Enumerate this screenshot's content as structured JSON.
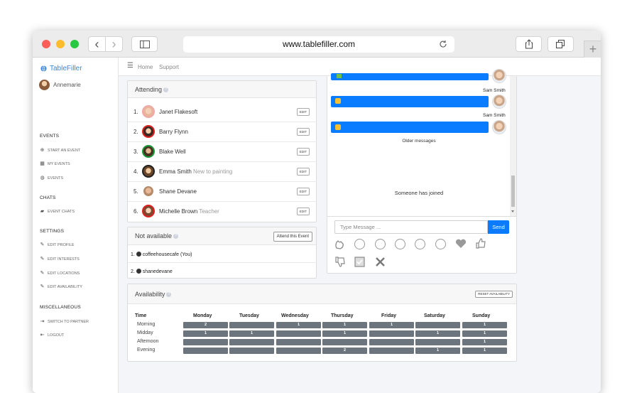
{
  "browser": {
    "url": "www.tablefiller.com",
    "back_glyph": "‹",
    "forward_glyph": "›",
    "new_tab_glyph": "+"
  },
  "sidebar": {
    "brand": "TableFiller",
    "user": "Annemarie",
    "sections": [
      {
        "title": "EVENTS",
        "items": [
          {
            "label": "START AN EVENT",
            "icon": "plus-circle-icon"
          },
          {
            "label": "MY EVENTS",
            "icon": "calendar-icon"
          },
          {
            "label": "EVENTS",
            "icon": "globe-icon"
          }
        ]
      },
      {
        "title": "CHATS",
        "items": [
          {
            "label": "EVENT CHATS",
            "icon": "chat-icon"
          }
        ]
      },
      {
        "title": "SETTINGS",
        "items": [
          {
            "label": "EDIT PROFILE",
            "icon": "edit-icon"
          },
          {
            "label": "EDIT INTERESTS",
            "icon": "edit-icon"
          },
          {
            "label": "EDIT LOCATIONS",
            "icon": "edit-icon"
          },
          {
            "label": "EDIT AVAILABILITY",
            "icon": "edit-icon"
          }
        ]
      },
      {
        "title": "MISCELLANEOUS",
        "items": [
          {
            "label": "SWITCH TO PARTNER",
            "icon": "sign-in-icon"
          },
          {
            "label": "LOGOUT",
            "icon": "sign-out-icon"
          }
        ]
      }
    ]
  },
  "topnav": {
    "home": "Home",
    "support": "Support",
    "menu_glyph": "☰"
  },
  "attending": {
    "title": "Attending",
    "edit_label": "EDIT",
    "rows": [
      {
        "num": "1.",
        "name": "Janet Flakesoft",
        "note": "",
        "ring": "#f0a8a8"
      },
      {
        "num": "2.",
        "name": "Barry Flynn",
        "note": "",
        "ring": "#e02020"
      },
      {
        "num": "3.",
        "name": "Blake Well",
        "note": "",
        "ring": "#1a9a3a"
      },
      {
        "num": "4.",
        "name": "Emma Smith",
        "note": "New to painting",
        "ring": "#222222"
      },
      {
        "num": "5.",
        "name": "Shane Devane",
        "note": "",
        "ring": "#ffffff"
      },
      {
        "num": "6.",
        "name": "Michelle Brown",
        "note": "Teacher",
        "ring": "#e02020"
      }
    ]
  },
  "not_available": {
    "title": "Not available",
    "attend_button": "Attend this Event",
    "rows": [
      {
        "num": "1.",
        "name": "coffeehousecafe (You)"
      },
      {
        "num": "2.",
        "name": "shanedevane"
      }
    ]
  },
  "chat": {
    "senders": [
      "Sam Smith",
      "Sam Smith"
    ],
    "older": "Older messages",
    "joined": "Someone has joined",
    "placeholder": "Type Message ...",
    "send": "Send",
    "accent": "#0a7cff"
  },
  "availability": {
    "title": "Availability",
    "reset": "RESET AVAILABILITY",
    "time_header": "Time",
    "days": [
      "Monday",
      "Tuesday",
      "Wednesday",
      "Thursday",
      "Friday",
      "Saturday",
      "Sunday"
    ],
    "slots": [
      "Morning",
      "Midday",
      "Afternoon",
      "Evening"
    ],
    "values": [
      [
        "2",
        "",
        "1",
        "1",
        "1",
        "",
        "1"
      ],
      [
        "1",
        "1",
        "",
        "1",
        "",
        "1",
        "1"
      ],
      [
        "",
        "",
        "",
        "",
        "",
        "",
        "1"
      ],
      [
        "",
        "",
        "",
        "2",
        "",
        "1",
        "1"
      ]
    ],
    "cell_color": "#6c757d"
  }
}
